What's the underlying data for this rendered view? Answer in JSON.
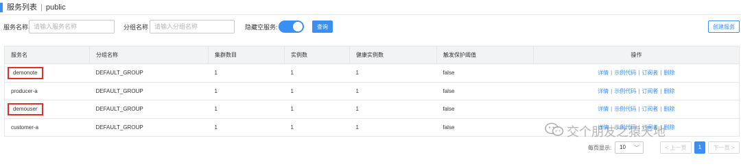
{
  "header": {
    "title": "服务列表",
    "separator": "|",
    "namespace": "public"
  },
  "filters": {
    "service_name_label": "服务名称",
    "service_name_placeholder": "请输入服务名称",
    "group_name_label": "分组名称",
    "group_name_placeholder": "请输入分组名称",
    "hide_empty_label": "隐藏空服务:",
    "hide_empty_on": true,
    "query_button": "查询",
    "create_button": "创建服务"
  },
  "table": {
    "columns": [
      "服务名",
      "分组名称",
      "集群数目",
      "实例数",
      "健康实例数",
      "触发保护阈值",
      "操作"
    ],
    "rows": [
      {
        "name": "demonote",
        "group": "DEFAULT_GROUP",
        "clusters": "1",
        "instances": "1",
        "healthy": "1",
        "protect": "false",
        "highlighted": true
      },
      {
        "name": "producer-a",
        "group": "DEFAULT_GROUP",
        "clusters": "1",
        "instances": "1",
        "healthy": "1",
        "protect": "false",
        "highlighted": false
      },
      {
        "name": "demouser",
        "group": "DEFAULT_GROUP",
        "clusters": "1",
        "instances": "1",
        "healthy": "1",
        "protect": "false",
        "highlighted": true
      },
      {
        "name": "customer-a",
        "group": "DEFAULT_GROUP",
        "clusters": "1",
        "instances": "1",
        "healthy": "1",
        "protect": "false",
        "highlighted": false
      }
    ],
    "actions": [
      "详情",
      "示例代码",
      "订阅者",
      "删除"
    ]
  },
  "pagination": {
    "page_size_label": "每页显示:",
    "page_size": "10",
    "prev_label": "< 上一页",
    "current_page": "1",
    "next_label": "下一页 >"
  },
  "watermark": {
    "text": "交个朋友之猿天地"
  },
  "colors": {
    "primary": "#3b8ef3",
    "highlight_border": "#e02d2d"
  }
}
